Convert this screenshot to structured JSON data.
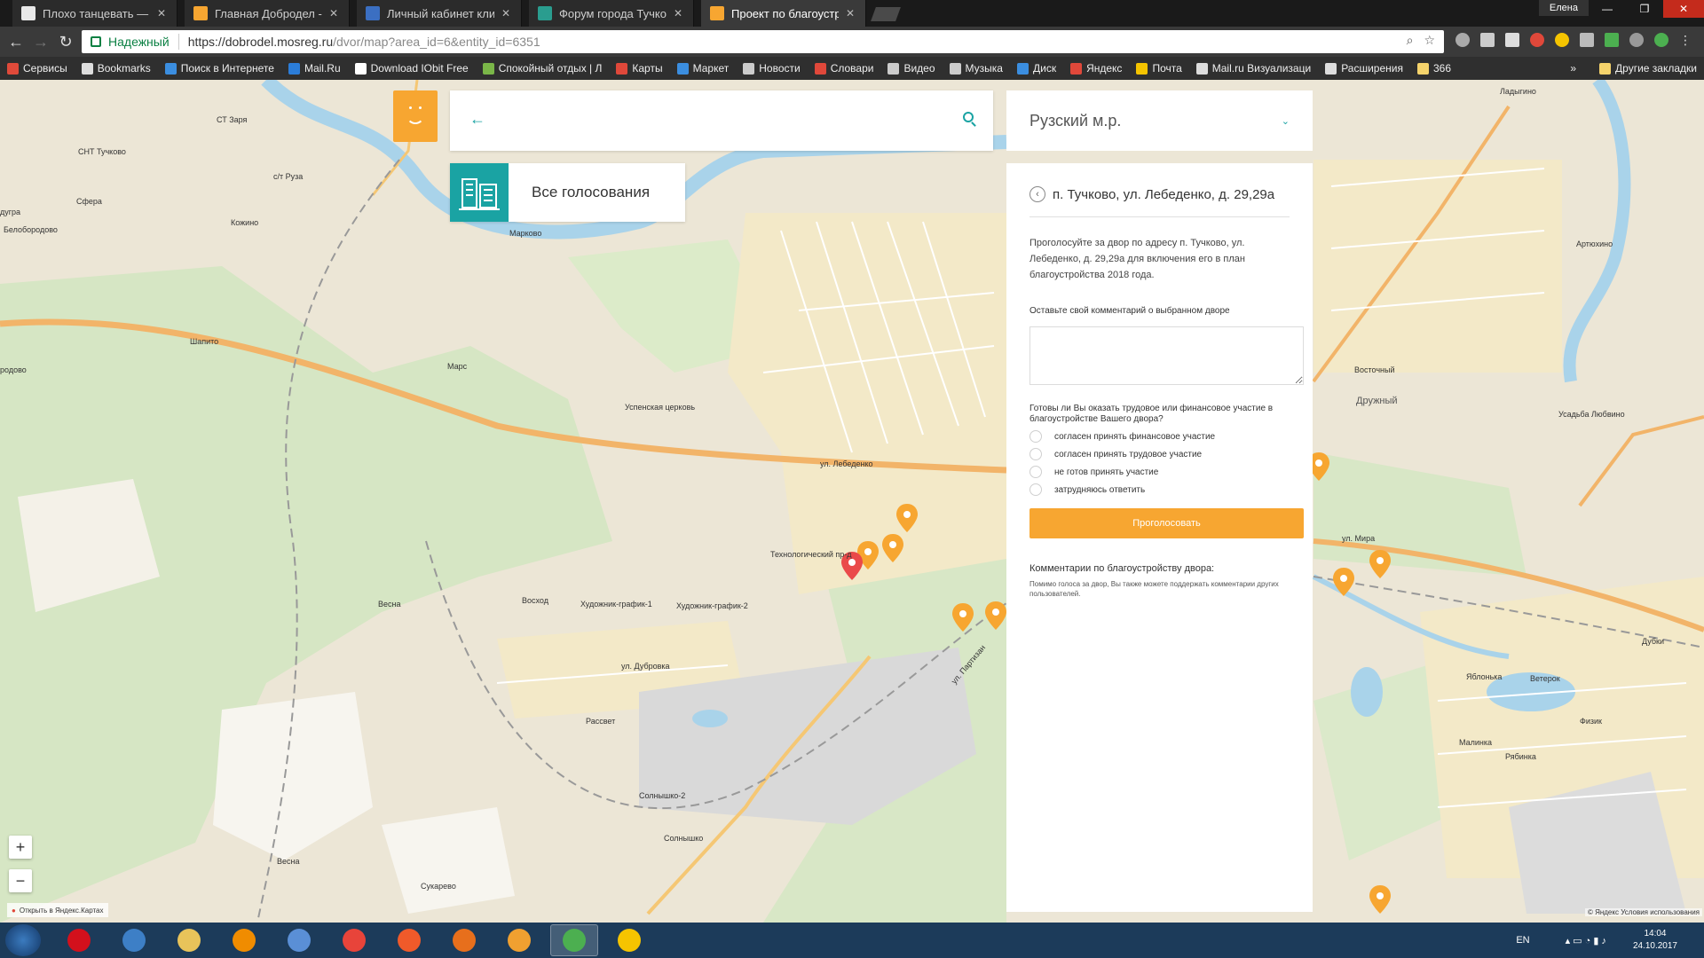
{
  "browser": {
    "tabs": [
      {
        "label": "Плохо танцевать — ",
        "favicon_color": "#e8e8e8",
        "active": false
      },
      {
        "label": "Главная Добродел - оф",
        "favicon_color": "#f7a631",
        "active": false
      },
      {
        "label": "Личный кабинет клиен",
        "favicon_color": "#3b6fc2",
        "active": false
      },
      {
        "label": "Форум города Тучково",
        "favicon_color": "#2a9d8f",
        "active": false
      },
      {
        "label": "Проект по благоустрой",
        "favicon_color": "#f7a631",
        "active": true
      }
    ],
    "user_label": "Елена",
    "secure_label": "Надежный",
    "url_host": "https://dobrodel.mosreg.ru",
    "url_path": "/dvor/map?area_id=6&entity_id=6351",
    "bookmarks": [
      {
        "label": "Сервисы",
        "color": "#e04a3a"
      },
      {
        "label": "Bookmarks",
        "color": "#dddddd"
      },
      {
        "label": "Поиск в Интернете",
        "color": "#3b8ee0"
      },
      {
        "label": "Mail.Ru",
        "color": "#2b7dd9"
      },
      {
        "label": "Download IObit Free",
        "color": "#ffffff"
      },
      {
        "label": "Спокойный отдых | Л",
        "color": "#7ab648"
      },
      {
        "label": "Карты",
        "color": "#e0483a"
      },
      {
        "label": "Маркет",
        "color": "#3b8ee0"
      },
      {
        "label": "Новости",
        "color": "#cccccc"
      },
      {
        "label": "Словари",
        "color": "#e0483a"
      },
      {
        "label": "Видео",
        "color": "#cccccc"
      },
      {
        "label": "Музыка",
        "color": "#cccccc"
      },
      {
        "label": "Диск",
        "color": "#3b8ee0"
      },
      {
        "label": "Яндекс",
        "color": "#e0483a"
      },
      {
        "label": "Почта",
        "color": "#f5c400"
      },
      {
        "label": "Mail.ru Визуализаци",
        "color": "#dddddd"
      },
      {
        "label": "Расширения",
        "color": "#dddddd"
      },
      {
        "label": "366",
        "color": "#f5d36b"
      }
    ],
    "bookmarks_more": "»",
    "other_bookmarks": "Другие закладки"
  },
  "page": {
    "back_arrow": "←",
    "all_votes_label": "Все голосования",
    "district_label": "Рузский м.р.",
    "address_title": "п. Тучково, ул. Лебеденко, д. 29,29а",
    "intro_text": "Проголосуйте за двор по адресу п. Тучково, ул. Лебеденко, д. 29,29а для включения его в план благоустройства 2018 года.",
    "comment_label": "Оставьте свой комментарий о выбранном дворе",
    "question": "Готовы ли Вы оказать трудовое или финансовое участие в благоустройстве Вашего двора?",
    "options": [
      "согласен принять финансовое участие",
      "согласен принять трудовое участие",
      "не готов принять участие",
      "затрудняюсь ответить"
    ],
    "vote_button": "Проголосовать",
    "comments_title": "Комментарии по благоустройству двора:",
    "comments_note": "Помимо голоса за двор, Вы также можете поддержать комментарии других пользователей.",
    "brand_color": "#f7a631",
    "accent_color": "#1aa3a3"
  },
  "map": {
    "zoom_in": "+",
    "zoom_out": "−",
    "open_in_yandex": "Открыть в Яндекс.Картах",
    "copyright": "© Яндекс Условия использования",
    "labels": [
      "СТ Заря",
      "СНТ Тучково",
      "с/т Руза",
      "Сфера",
      "Кожино",
      "дугра",
      "Белобородово",
      "Марково",
      "Шапито",
      "Марс",
      "родово",
      "Весна",
      "Восход",
      "Художник-график-1",
      "Художник-график-2",
      "ул. Дубровка",
      "Рассвет",
      "Солнышко-2",
      "Солнышко",
      "Весна",
      "Сукарево",
      "Технологический пр-д",
      "ул. Лебеденко",
      "ул. Партизан",
      "Ладыгино",
      "Артюхино",
      "Восточный",
      "Дружный",
      "ул. Мира",
      "Дубки",
      "Яблонька",
      "Ветерок",
      "Малинка",
      "Рябинка",
      "Физик",
      "Усадьба Любвино",
      "Успенская церковь"
    ]
  },
  "taskbar": {
    "language": "EN",
    "time": "14:04",
    "date": "24.10.2017",
    "apps": [
      {
        "name": "opera",
        "color": "#d3101c"
      },
      {
        "name": "mail",
        "color": "#3d7fc6"
      },
      {
        "name": "explorer",
        "color": "#e8c35a"
      },
      {
        "name": "mail-agent",
        "color": "#f08c00"
      },
      {
        "name": "audio",
        "color": "#5a8fd6"
      },
      {
        "name": "yandex",
        "color": "#e8443a"
      },
      {
        "name": "ok-app",
        "color": "#f05a2a"
      },
      {
        "name": "firefox",
        "color": "#e76f1c"
      },
      {
        "name": "media-player",
        "color": "#f0a030"
      },
      {
        "name": "chrome",
        "color": "#4caf50"
      },
      {
        "name": "game",
        "color": "#f5c400"
      }
    ]
  }
}
